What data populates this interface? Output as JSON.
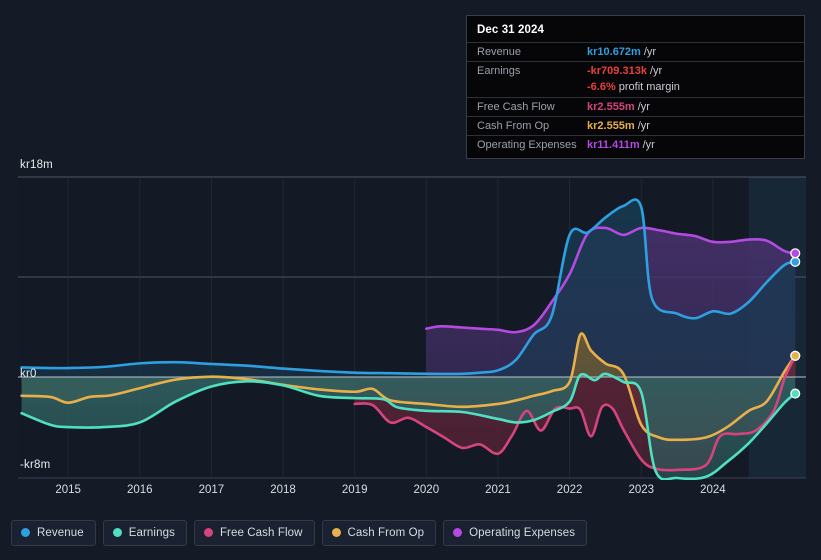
{
  "chart_data": {
    "type": "area",
    "title": "",
    "xlabel": "",
    "ylabel": "",
    "currency_prefix": "kr",
    "grid": true,
    "legend_position": "bottom",
    "ylim": [
      -8,
      18
    ],
    "xlim": [
      2014.3,
      2025.3
    ],
    "y_ticks": [
      {
        "value": 18,
        "label": "kr18m"
      },
      {
        "value": 0,
        "label": "kr0"
      },
      {
        "value": -8,
        "label": "-kr8m"
      }
    ],
    "x_ticks": [
      "2015",
      "2016",
      "2017",
      "2018",
      "2019",
      "2020",
      "2021",
      "2022",
      "2023",
      "2024"
    ],
    "series": [
      {
        "name": "Revenue",
        "color": "#2e9fe0",
        "fill": "#17394f",
        "start_x": 2014.35,
        "x": [
          2014.35,
          2014.75,
          2015.0,
          2015.5,
          2016.0,
          2016.5,
          2017.0,
          2017.5,
          2018.0,
          2018.5,
          2019.0,
          2019.5,
          2020.0,
          2020.5,
          2020.75,
          2021.0,
          2021.25,
          2021.5,
          2021.75,
          2022.0,
          2022.25,
          2022.5,
          2022.75,
          2023.0,
          2023.15,
          2023.5,
          2023.75,
          2024.0,
          2024.25,
          2024.5,
          2024.75,
          2025.0,
          2025.15
        ],
        "values": [
          1.55,
          1.5,
          1.5,
          1.6,
          1.9,
          2.0,
          1.85,
          1.7,
          1.45,
          1.25,
          1.1,
          1.05,
          1.0,
          1.0,
          1.1,
          1.3,
          2.2,
          4.4,
          6.0,
          13.0,
          13.2,
          14.5,
          15.5,
          15.4,
          7.5,
          6.2,
          5.8,
          6.4,
          6.2,
          7.2,
          8.9,
          10.4,
          10.672
        ]
      },
      {
        "name": "Earnings",
        "color": "#4fe0c0",
        "fill": "#2f5f60",
        "start_x": 2014.35,
        "x": [
          2014.35,
          2014.75,
          2015.0,
          2015.5,
          2016.0,
          2016.5,
          2017.0,
          2017.5,
          2018.0,
          2018.5,
          2019.0,
          2019.4,
          2019.6,
          2020.0,
          2020.5,
          2021.0,
          2021.25,
          2021.5,
          2021.75,
          2022.0,
          2022.15,
          2022.35,
          2022.5,
          2022.75,
          2023.0,
          2023.2,
          2023.5,
          2023.9,
          2024.2,
          2024.5,
          2024.75,
          2025.0,
          2025.15
        ],
        "values": [
          -2.4,
          -3.4,
          -3.6,
          -3.6,
          -3.2,
          -1.4,
          -0.1,
          0.35,
          0.0,
          -0.9,
          -1.1,
          -1.2,
          -1.9,
          -2.2,
          -2.3,
          -2.9,
          -3.2,
          -3.0,
          -2.3,
          -1.4,
          0.9,
          0.45,
          1.0,
          0.3,
          -0.6,
          -7.4,
          -8.0,
          -7.9,
          -6.6,
          -5.0,
          -3.3,
          -1.5,
          -0.709
        ]
      },
      {
        "name": "Free Cash Flow",
        "color": "#d6447d",
        "fill": "#5f2438",
        "start_x": 2019.0,
        "x": [
          2019.0,
          2019.25,
          2019.5,
          2019.75,
          2020.0,
          2020.25,
          2020.5,
          2020.75,
          2021.0,
          2021.2,
          2021.4,
          2021.6,
          2021.8,
          2022.0,
          2022.15,
          2022.3,
          2022.45,
          2022.6,
          2022.75,
          2023.0,
          2023.2,
          2023.5,
          2023.9,
          2024.1,
          2024.35,
          2024.6,
          2024.85,
          2025.0,
          2025.15
        ],
        "values": [
          -1.6,
          -1.7,
          -3.2,
          -2.8,
          -3.6,
          -4.5,
          -5.4,
          -5.1,
          -5.9,
          -4.3,
          -2.2,
          -3.9,
          -2.0,
          -2.0,
          -2.1,
          -4.4,
          -1.9,
          -2.0,
          -3.8,
          -6.4,
          -7.2,
          -7.3,
          -6.9,
          -4.4,
          -4.2,
          -3.9,
          -2.2,
          0.6,
          2.555
        ]
      },
      {
        "name": "Cash From Op",
        "color": "#e8b04b",
        "fill": "#6b5a33",
        "start_x": 2014.35,
        "x": [
          2014.35,
          2014.75,
          2015.0,
          2015.3,
          2015.6,
          2016.0,
          2016.5,
          2017.0,
          2017.4,
          2017.7,
          2018.0,
          2018.5,
          2019.0,
          2019.25,
          2019.5,
          2020.0,
          2020.5,
          2021.0,
          2021.25,
          2021.5,
          2021.75,
          2022.0,
          2022.15,
          2022.3,
          2022.5,
          2022.75,
          2023.0,
          2023.25,
          2023.5,
          2023.9,
          2024.2,
          2024.5,
          2024.75,
          2025.0,
          2025.15
        ],
        "values": [
          -0.9,
          -1.0,
          -1.5,
          -1.0,
          -0.85,
          -0.25,
          0.5,
          0.75,
          0.6,
          0.35,
          0.05,
          -0.35,
          -0.55,
          -0.3,
          -1.3,
          -1.6,
          -1.85,
          -1.6,
          -1.3,
          -0.9,
          -0.5,
          0.3,
          4.4,
          3.0,
          1.9,
          1.0,
          -3.4,
          -4.5,
          -4.7,
          -4.5,
          -3.6,
          -2.2,
          -1.4,
          1.2,
          2.555
        ]
      },
      {
        "name": "Operating Expenses",
        "color": "#b44ae0",
        "fill": "#46316b",
        "start_x": 2020.0,
        "x": [
          2020.0,
          2020.2,
          2020.5,
          2020.75,
          2021.0,
          2021.25,
          2021.5,
          2021.75,
          2022.0,
          2022.25,
          2022.5,
          2022.75,
          2023.0,
          2023.25,
          2023.5,
          2023.75,
          2024.0,
          2024.25,
          2024.5,
          2024.75,
          2025.0,
          2025.15
        ],
        "values": [
          4.9,
          5.1,
          5.0,
          4.9,
          4.8,
          4.6,
          5.2,
          7.2,
          9.6,
          13.1,
          13.6,
          13.0,
          13.6,
          13.4,
          13.1,
          12.9,
          12.4,
          12.4,
          12.6,
          12.5,
          11.6,
          11.411
        ]
      }
    ],
    "endpoints": [
      {
        "name": "Operating Expenses",
        "value": 11.411,
        "color": "#b44ae0"
      },
      {
        "name": "Revenue",
        "value": 10.672,
        "color": "#2e9fe0"
      },
      {
        "name": "Cash From Op",
        "value": 2.555,
        "color": "#e8b04b"
      },
      {
        "name": "Free Cash Flow",
        "value": 2.555,
        "color": "#d6447d"
      },
      {
        "name": "Earnings",
        "value": -0.709,
        "color": "#4fe0c0"
      }
    ],
    "forecast_band": {
      "start_x": 2024.5,
      "end_x": 2025.3
    }
  },
  "tooltip": {
    "date": "Dec 31 2024",
    "rows": [
      {
        "label": "Revenue",
        "value": "kr10.672m",
        "unit": "/yr",
        "color": "#2e9fe0"
      },
      {
        "label": "Earnings",
        "value": "-kr709.313k",
        "unit": "/yr",
        "color": "#e8413c"
      },
      {
        "label": "Free Cash Flow",
        "value": "kr2.555m",
        "unit": "/yr",
        "color": "#d6447d"
      },
      {
        "label": "Cash From Op",
        "value": "kr2.555m",
        "unit": "/yr",
        "color": "#e8b04b"
      },
      {
        "label": "Operating Expenses",
        "value": "kr11.411m",
        "unit": "/yr",
        "color": "#b44ae0"
      }
    ],
    "margin_value": "-6.6%",
    "margin_label": "profit margin",
    "margin_color": "#e8413c"
  },
  "legend": {
    "items": [
      {
        "label": "Revenue",
        "color": "#2e9fe0"
      },
      {
        "label": "Earnings",
        "color": "#4fe0c0"
      },
      {
        "label": "Free Cash Flow",
        "color": "#d6447d"
      },
      {
        "label": "Cash From Op",
        "color": "#e8b04b"
      },
      {
        "label": "Operating Expenses",
        "color": "#b44ae0"
      }
    ]
  }
}
